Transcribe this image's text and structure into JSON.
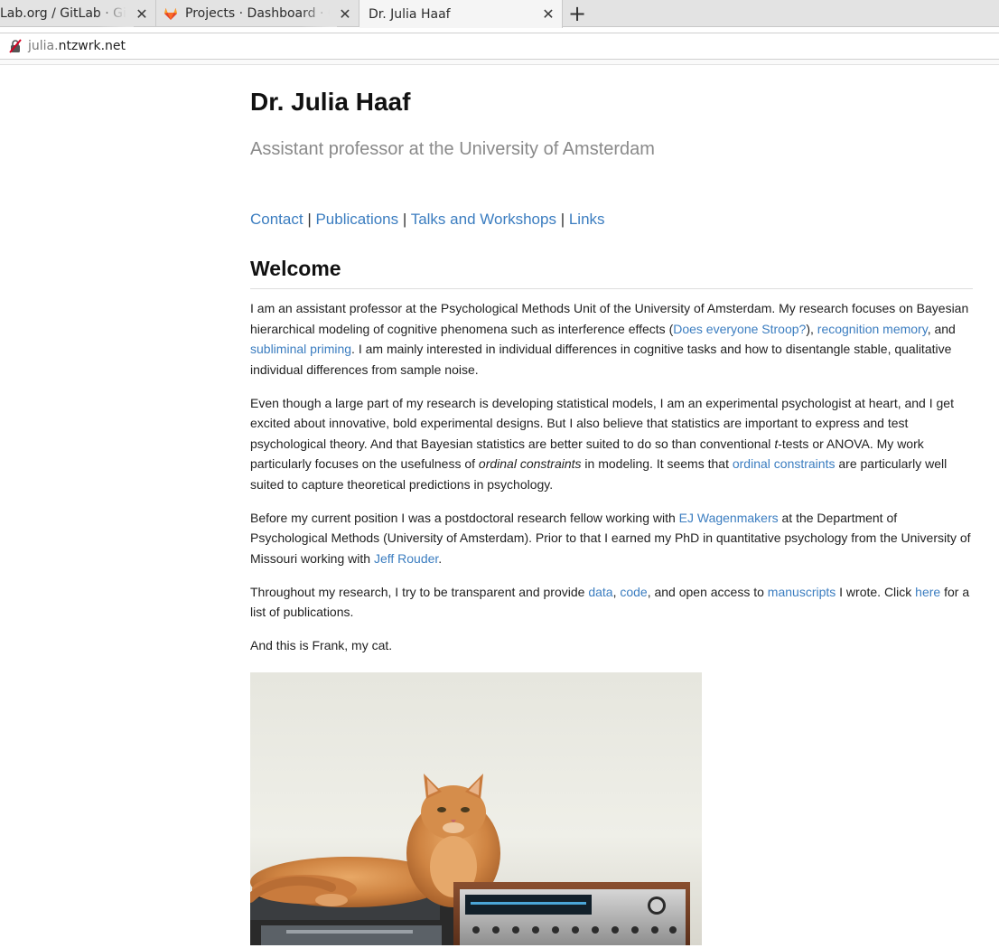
{
  "browser": {
    "tabs": [
      {
        "title": "Lab.org / GitLab · GitLab",
        "active": false
      },
      {
        "title": "Projects · Dashboard · GitLab",
        "active": false
      },
      {
        "title": "Dr. Julia Haaf",
        "active": true
      }
    ],
    "url_subdomain": "julia.",
    "url_host": "ntzwrk.net"
  },
  "page": {
    "name": "Dr. Julia Haaf",
    "subtitle": "Assistant professor at the University of Amsterdam",
    "nav": [
      {
        "label": "Contact"
      },
      {
        "label": "Publications"
      },
      {
        "label": "Talks and Workshops"
      },
      {
        "label": "Links"
      }
    ],
    "nav_separator": " | ",
    "welcome_heading": "Welcome",
    "p1": {
      "t1": "I am an assistant professor at the Psychological Methods Unit of the University of Amsterdam. My research focuses on Bayesian hierarchical modeling of cognitive phenomena such as interference effects (",
      "l1": "Does everyone Stroop?",
      "t2": "), ",
      "l2": "recognition memory",
      "t3": ", and ",
      "l3": "subliminal priming",
      "t4": ". I am mainly interested in individual differences in cognitive tasks and how to disentangle stable, qualitative individual differences from sample noise."
    },
    "p2": {
      "t1": "Even though a large part of my research is developing statistical models, I am an experimental psychologist at heart, and I get excited about innovative, bold experimental designs. But I also believe that statistics are important to express and test psychological theory. And that Bayesian statistics are better suited to do so than conventional ",
      "i1": "t",
      "t2": "-tests or ANOVA. My work particularly focuses on the usefulness of ",
      "i2": "ordinal constraints",
      "t3": " in modeling. It seems that ",
      "l1": "ordinal constraints",
      "t4": " are particularly well suited to capture theoretical predictions in psychology."
    },
    "p3": {
      "t1": "Before my current position I was a postdoctoral research fellow working with ",
      "l1": "EJ Wagenmakers",
      "t2": " at the Department of Psychological Methods (University of Amsterdam). Prior to that I earned my PhD in quantitative psychology from the University of Missouri working with ",
      "l2": "Jeff Rouder",
      "t3": "."
    },
    "p4": {
      "t1": "Throughout my research, I try to be transparent and provide ",
      "l1": "data",
      "t2": ", ",
      "l2": "code",
      "t3": ", and open access to ",
      "l3": "manuscripts",
      "t4": " I wrote. Click ",
      "l4": "here",
      "t5": " for a list of publications."
    },
    "p5": "And this is Frank, my cat."
  },
  "colors": {
    "link": "#3b7dc0",
    "subtitle": "#8a8a8a",
    "gitlab_orange": "#e24329"
  },
  "icons": {
    "tab_close": "close-icon",
    "new_tab": "plus-icon",
    "url_security": "insecure-connection-icon",
    "gitlab": "gitlab-fox-icon"
  }
}
